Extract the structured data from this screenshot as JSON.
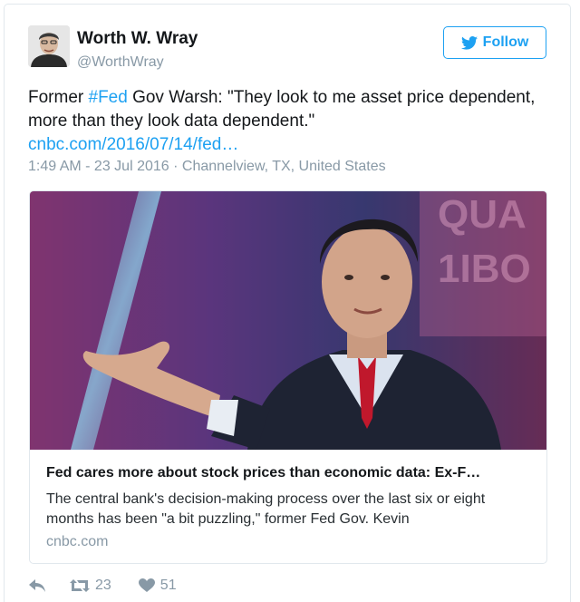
{
  "author": {
    "name": "Worth W. Wray",
    "handle": "@WorthWray"
  },
  "follow_button": {
    "label": "Follow"
  },
  "tweet": {
    "text_before": "Former ",
    "hashtag": "#Fed",
    "text_after": " Gov Warsh: \"They look to me asset price dependent, more than they look data dependent.\"",
    "link": "cnbc.com/2016/07/14/fed…",
    "timestamp": "1:49 AM - 23 Jul 2016",
    "separator": "·",
    "location": "Channelview, TX, United States"
  },
  "card": {
    "title": "Fed cares more about stock prices than economic data: Ex-F…",
    "description": "The central bank's decision-making process over the last six or eight months has been \"a bit puzzling,\" former Fed Gov. Kevin",
    "domain": "cnbc.com"
  },
  "actions": {
    "reply_icon": "reply-icon",
    "retweet_icon": "retweet-icon",
    "retweet_count": "23",
    "like_icon": "heart-icon",
    "like_count": "51"
  },
  "colors": {
    "accent": "#1da1f2",
    "muted": "#8899a6",
    "text": "#14171a"
  }
}
